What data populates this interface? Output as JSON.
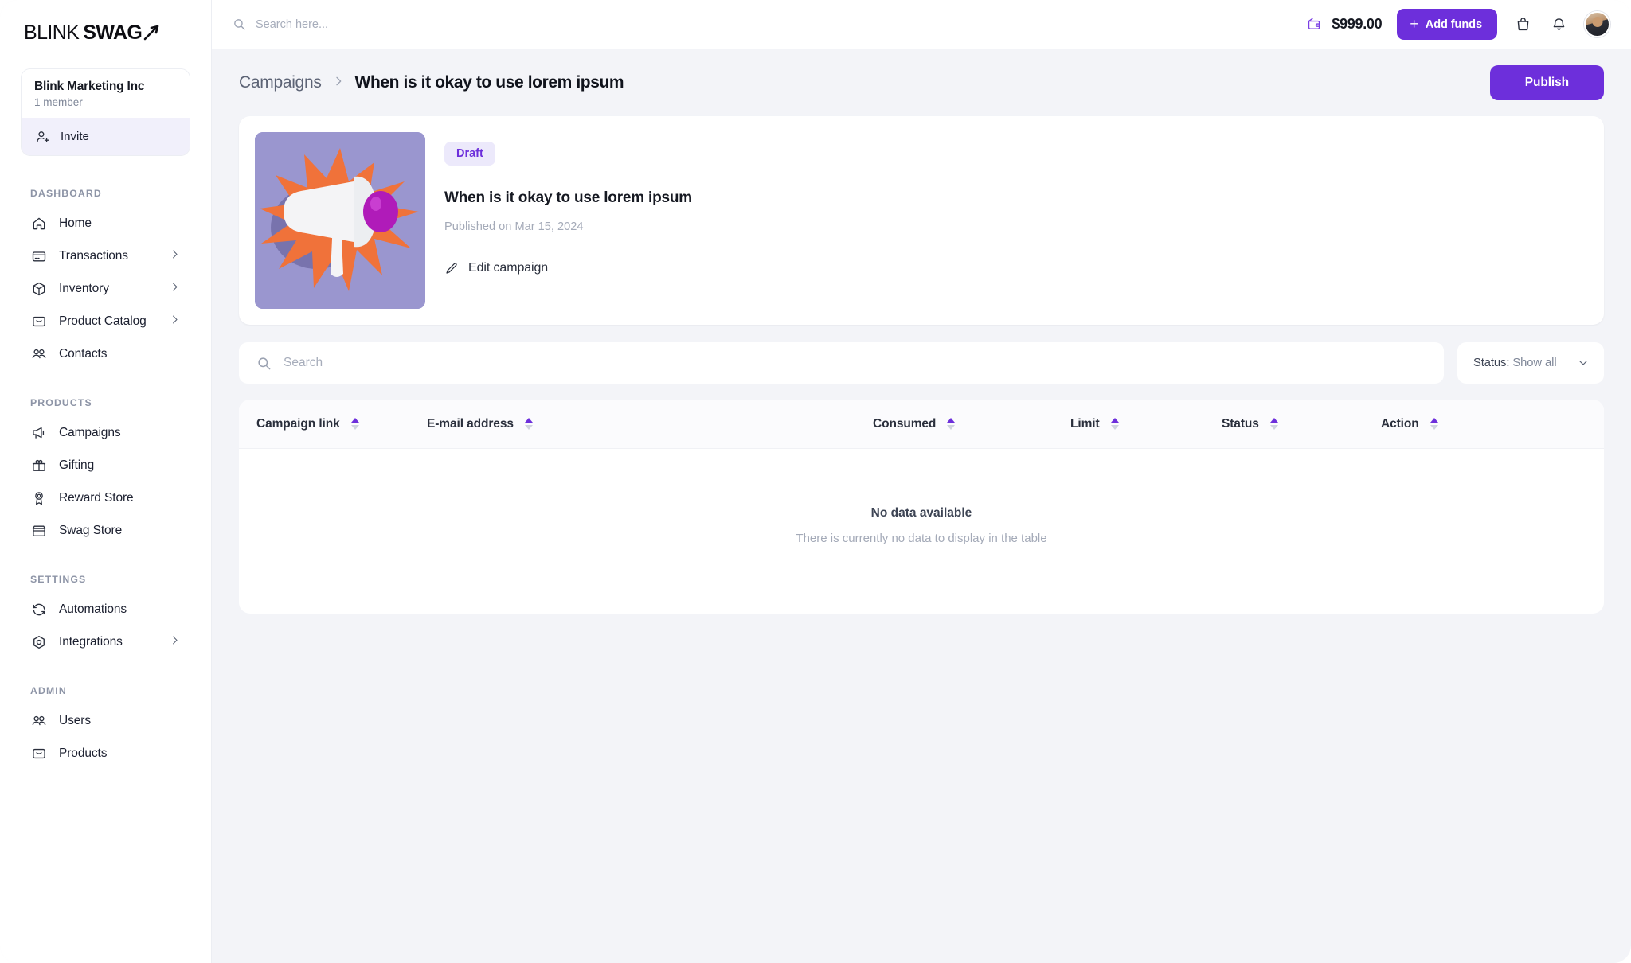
{
  "brand": {
    "logo_part1": "BLINK",
    "logo_part2": "SWAG",
    "logo_icon": "rocket-swoosh-icon"
  },
  "org": {
    "name": "Blink Marketing Inc",
    "members": "1 member",
    "invite_label": "Invite"
  },
  "topbar": {
    "search_placeholder": "Search here...",
    "search_value": "",
    "balance": "$999.00",
    "add_funds_label": "Add funds",
    "plus": "+"
  },
  "sidebar": {
    "sections": [
      {
        "title": "DASHBOARD",
        "items": [
          {
            "label": "Home",
            "icon": "home-icon",
            "chevron": false
          },
          {
            "label": "Transactions",
            "icon": "credit-card-icon",
            "chevron": true
          },
          {
            "label": "Inventory",
            "icon": "box-icon",
            "chevron": true
          },
          {
            "label": "Product Catalog",
            "icon": "catalog-icon",
            "chevron": true
          },
          {
            "label": "Contacts",
            "icon": "contacts-icon",
            "chevron": false
          }
        ]
      },
      {
        "title": "PRODUCTS",
        "items": [
          {
            "label": "Campaigns",
            "icon": "megaphone-icon",
            "chevron": false
          },
          {
            "label": "Gifting",
            "icon": "gift-icon",
            "chevron": false
          },
          {
            "label": "Reward Store",
            "icon": "award-icon",
            "chevron": false
          },
          {
            "label": "Swag Store",
            "icon": "store-icon",
            "chevron": false
          }
        ]
      },
      {
        "title": "SETTINGS",
        "items": [
          {
            "label": "Automations",
            "icon": "refresh-icon",
            "chevron": false
          },
          {
            "label": "Integrations",
            "icon": "target-icon",
            "chevron": true
          }
        ]
      },
      {
        "title": "ADMIN",
        "items": [
          {
            "label": "Users",
            "icon": "contacts-icon",
            "chevron": false
          },
          {
            "label": "Products",
            "icon": "catalog-icon",
            "chevron": false
          }
        ]
      }
    ]
  },
  "breadcrumb": {
    "root": "Campaigns",
    "current": "When is it okay to use lorem ipsum"
  },
  "actions": {
    "publish_label": "Publish"
  },
  "campaign": {
    "status_badge": "Draft",
    "title": "When is it okay to use lorem ipsum",
    "published": "Published on Mar 15, 2024",
    "edit_label": "Edit campaign",
    "thumbnail": "megaphone-burst-image"
  },
  "filters": {
    "search_placeholder": "Search",
    "search_value": "",
    "status_label": "Status: ",
    "status_value": "Show all"
  },
  "table": {
    "columns": [
      {
        "label": "Campaign link"
      },
      {
        "label": "E-mail address"
      },
      {
        "label": "Consumed"
      },
      {
        "label": "Limit"
      },
      {
        "label": "Status"
      },
      {
        "label": "Action"
      }
    ],
    "rows": [],
    "empty_title": "No data available",
    "empty_sub": "There is currently no data to display in the table"
  },
  "colors": {
    "accent": "#6d2fdb",
    "badge_bg": "#ece9fb",
    "page_bg": "#f3f4f8",
    "sidebar_bg": "#ffffff"
  }
}
